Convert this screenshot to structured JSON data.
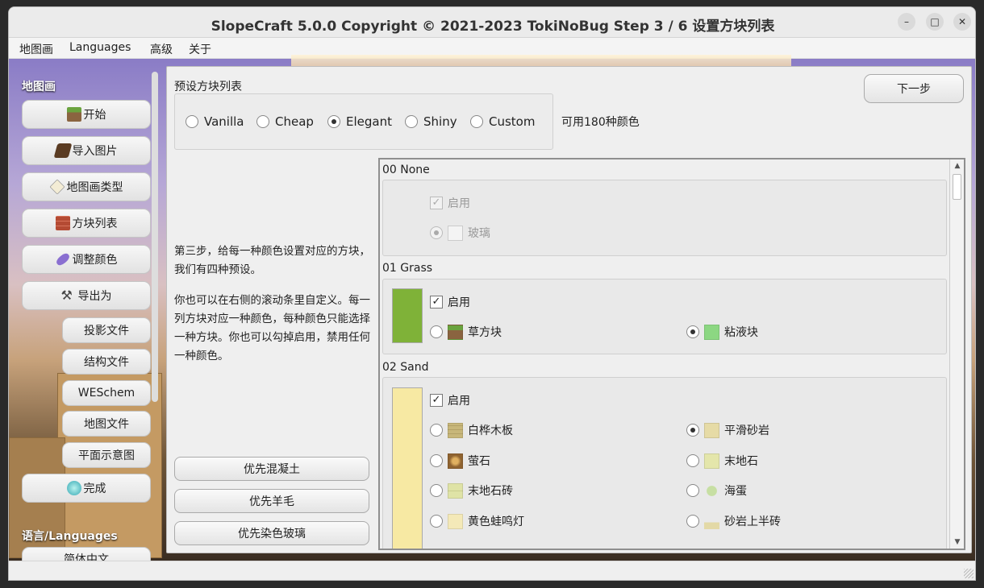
{
  "window": {
    "title": "SlopeCraft 5.0.0 Copyright © 2021-2023 TokiNoBug    Step 3 / 6   设置方块列表"
  },
  "menu": {
    "items": [
      "地图画",
      "Languages",
      "高级",
      "关于"
    ]
  },
  "sidebar": {
    "section1": "地图画",
    "section2": "语言/Languages",
    "items": [
      {
        "label": "开始",
        "icon": "grass-block-icon"
      },
      {
        "label": "导入图片",
        "icon": "book-icon"
      },
      {
        "label": "地图画类型",
        "icon": "map-icon"
      },
      {
        "label": "方块列表",
        "icon": "brick-icon"
      },
      {
        "label": "调整颜色",
        "icon": "dye-icon"
      },
      {
        "label": "导出为",
        "icon": "pickaxe-icon"
      }
    ],
    "sub_items": [
      "投影文件",
      "结构文件",
      "WESchem",
      "地图文件",
      "平面示意图"
    ],
    "finish": {
      "label": "完成",
      "icon": "diamond-icon"
    },
    "language_item": "简体中文"
  },
  "main": {
    "preset_title": "预设方块列表",
    "presets": [
      "Vanilla",
      "Cheap",
      "Elegant",
      "Shiny",
      "Custom"
    ],
    "selected_preset": "Elegant",
    "colors_available": "可用180种颜色",
    "next_button": "下一步",
    "description_1": "第三步，给每一种颜色设置对应的方块，我们有四种预设。",
    "description_2": "你也可以在右侧的滚动条里自定义。每一列方块对应一种颜色，每种颜色只能选择一种方块。你也可以勾掉启用，禁用任何一种颜色。",
    "priority_buttons": [
      "优先混凝土",
      "优先羊毛",
      "优先染色玻璃"
    ]
  },
  "block_list": {
    "enable_label": "启用",
    "colors": [
      {
        "id": "00 None",
        "enabled": true,
        "disabled_ui": true,
        "swatch": null,
        "blocks": [
          {
            "name": "玻璃",
            "selected": true,
            "color": "#f4f4f4"
          }
        ]
      },
      {
        "id": "01 Grass",
        "enabled": true,
        "swatch": "#7fb238",
        "blocks": [
          {
            "name": "草方块",
            "selected": false,
            "color": "#6b8f3a"
          },
          {
            "name": "粘液块",
            "selected": true,
            "color": "#8cd782"
          }
        ]
      },
      {
        "id": "02 Sand",
        "enabled": true,
        "swatch": "#f7e9a3",
        "blocks": [
          {
            "name": "白桦木板",
            "selected": false,
            "color": "#c8b77a"
          },
          {
            "name": "平滑砂岩",
            "selected": true,
            "color": "#e6dba6"
          },
          {
            "name": "萤石",
            "selected": false,
            "color": "#a57a3e"
          },
          {
            "name": "末地石",
            "selected": false,
            "color": "#e4e6ab"
          },
          {
            "name": "末地石砖",
            "selected": false,
            "color": "#dfe3a6"
          },
          {
            "name": "海蛋",
            "selected": false,
            "color": "#9cc07a"
          },
          {
            "name": "黄色蛙鸣灯",
            "selected": false,
            "color": "#f4e9b8"
          },
          {
            "name": "砂岩上半砖",
            "selected": false,
            "color": "#e3d9a6"
          }
        ]
      }
    ]
  }
}
